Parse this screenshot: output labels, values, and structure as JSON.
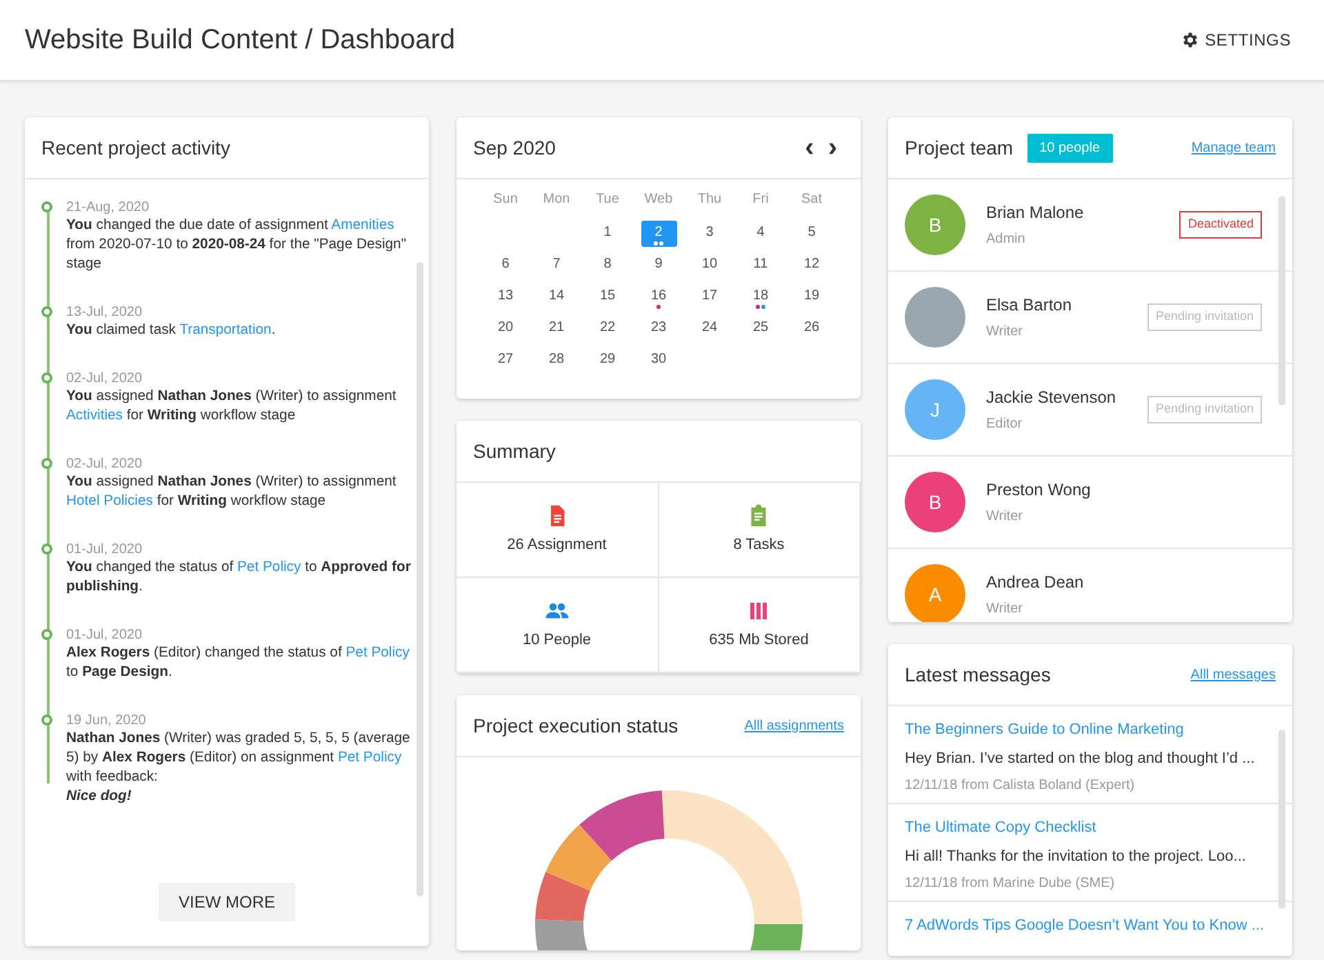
{
  "header": {
    "title": "Website Build Content / Dashboard",
    "settings": "SETTINGS"
  },
  "activity": {
    "title": "Recent project activity",
    "button": "VIEW MORE",
    "entries": [
      {
        "date": "21-Aug, 2020",
        "text": [
          {
            "kind": "bold",
            "text": "You"
          },
          {
            "kind": "plain",
            "text": " changed the due date of assignment "
          },
          {
            "kind": "link",
            "text": "Amenities"
          },
          {
            "kind": "plain",
            "text": " from 2020-07-10 to "
          },
          {
            "kind": "bold",
            "text": "2020-08-24"
          },
          {
            "kind": "plain",
            "text": " for the \"Page Design\" stage"
          }
        ]
      },
      {
        "date": "13-Jul, 2020",
        "text": [
          {
            "kind": "bold",
            "text": "You"
          },
          {
            "kind": "plain",
            "text": " claimed task "
          },
          {
            "kind": "link",
            "text": "Transportation"
          },
          {
            "kind": "plain",
            "text": "."
          }
        ]
      },
      {
        "date": "02-Jul, 2020",
        "text": [
          {
            "kind": "bold",
            "text": "You"
          },
          {
            "kind": "plain",
            "text": " assigned "
          },
          {
            "kind": "bold",
            "text": "Nathan Jones"
          },
          {
            "kind": "plain",
            "text": " (Writer) to assignment "
          },
          {
            "kind": "link",
            "text": "Activities"
          },
          {
            "kind": "plain",
            "text": " for "
          },
          {
            "kind": "bold",
            "text": "Writing"
          },
          {
            "kind": "plain",
            "text": " workflow stage"
          }
        ]
      },
      {
        "date": "02-Jul, 2020",
        "text": [
          {
            "kind": "bold",
            "text": "You"
          },
          {
            "kind": "plain",
            "text": " assigned "
          },
          {
            "kind": "bold",
            "text": "Nathan Jones"
          },
          {
            "kind": "plain",
            "text": " (Writer) to assignment "
          },
          {
            "kind": "link",
            "text": "Hotel Policies"
          },
          {
            "kind": "plain",
            "text": " for "
          },
          {
            "kind": "bold",
            "text": "Writing"
          },
          {
            "kind": "plain",
            "text": " workflow stage"
          }
        ]
      },
      {
        "date": "01-Jul, 2020",
        "text": [
          {
            "kind": "bold",
            "text": "You"
          },
          {
            "kind": "plain",
            "text": " changed the status of "
          },
          {
            "kind": "link",
            "text": "Pet Policy"
          },
          {
            "kind": "plain",
            "text": " to "
          },
          {
            "kind": "bold",
            "text": "Approved for publishing"
          },
          {
            "kind": "plain",
            "text": "."
          }
        ]
      },
      {
        "date": "01-Jul, 2020",
        "text": [
          {
            "kind": "bold",
            "text": "Alex Rogers"
          },
          {
            "kind": "plain",
            "text": " (Editor) changed the status of "
          },
          {
            "kind": "link",
            "text": "Pet Policy"
          },
          {
            "kind": "plain",
            "text": " to "
          },
          {
            "kind": "bold",
            "text": "Page Design"
          },
          {
            "kind": "plain",
            "text": "."
          }
        ]
      },
      {
        "date": "19 Jun, 2020",
        "text": [
          {
            "kind": "bold",
            "text": "Nathan Jones"
          },
          {
            "kind": "plain",
            "text": " (Writer) was graded 5, 5, 5, 5 (average 5) by "
          },
          {
            "kind": "bold",
            "text": "Alex Rogers"
          },
          {
            "kind": "plain",
            "text": " (Editor) on assignment "
          },
          {
            "kind": "link",
            "text": "Pet Policy"
          },
          {
            "kind": "plain",
            "text": " with feedback:"
          },
          {
            "kind": "quote",
            "text": "Nice dog!"
          }
        ]
      }
    ]
  },
  "calendar": {
    "title": "Sep 2020",
    "prev": "‹",
    "next": "›",
    "weekdays": [
      "Sun",
      "Mon",
      "Tue",
      "Web",
      "Thu",
      "Fri",
      "Sat"
    ],
    "weeks": [
      {
        "kind": "leading",
        "days": [
          {
            "day": "1",
            "selected": false
          },
          {
            "day": "2",
            "selected": true,
            "events": [
              {
                "color": "#ffffff"
              },
              {
                "color": "#ffffff"
              }
            ]
          },
          {
            "day": "3",
            "selected": false
          },
          {
            "day": "4",
            "selected": false
          },
          {
            "day": "5",
            "selected": false
          }
        ]
      },
      {
        "kind": "full",
        "days": [
          {
            "day": "6",
            "selected": false
          },
          {
            "day": "7",
            "selected": false
          },
          {
            "day": "8",
            "selected": false
          },
          {
            "day": "9",
            "selected": false
          },
          {
            "day": "10",
            "selected": false
          },
          {
            "day": "11",
            "selected": false
          },
          {
            "day": "12",
            "selected": false
          }
        ]
      },
      {
        "kind": "full",
        "days": [
          {
            "day": "13",
            "selected": false
          },
          {
            "day": "14",
            "selected": false
          },
          {
            "day": "15",
            "selected": false
          },
          {
            "day": "16",
            "selected": false,
            "events": [
              {
                "color": "#e91e63"
              }
            ]
          },
          {
            "day": "17",
            "selected": false
          },
          {
            "day": "18",
            "selected": false,
            "events": [
              {
                "color": "#e91e63"
              },
              {
                "color": "#2196f3"
              }
            ]
          },
          {
            "day": "19",
            "selected": false
          }
        ]
      },
      {
        "kind": "full",
        "days": [
          {
            "day": "20",
            "selected": false
          },
          {
            "day": "21",
            "selected": false
          },
          {
            "day": "22",
            "selected": false
          },
          {
            "day": "23",
            "selected": false
          },
          {
            "day": "24",
            "selected": false
          },
          {
            "day": "25",
            "selected": false
          },
          {
            "day": "26",
            "selected": false
          }
        ]
      },
      {
        "kind": "trailing",
        "days": [
          {
            "day": "27",
            "selected": false
          },
          {
            "day": "28",
            "selected": false
          },
          {
            "day": "29",
            "selected": false
          },
          {
            "day": "30",
            "selected": false
          }
        ]
      }
    ]
  },
  "summary": {
    "title": "Summary",
    "items": [
      {
        "kind": "assignment",
        "label": "26 Assignment"
      },
      {
        "kind": "tasks",
        "label": "8 Tasks"
      },
      {
        "kind": "people",
        "label": "10 People"
      },
      {
        "kind": "storage",
        "label": "635 Mb Stored"
      }
    ]
  },
  "execution": {
    "title": "Project execution status",
    "link": "Alll assignments"
  },
  "team": {
    "title": "Project team",
    "count": "10 people",
    "link": "Manage team",
    "members": [
      {
        "name": "Brian Malone",
        "role": "Admin",
        "avatar": {
          "kind": "initial",
          "text": "B",
          "color": "#7cb342"
        },
        "status": {
          "kind": "danger",
          "label": "Deactivated"
        }
      },
      {
        "name": "Elsa Barton",
        "role": "Writer",
        "avatar": {
          "kind": "photo"
        },
        "status": {
          "kind": "muted",
          "label": "Pending invitation"
        }
      },
      {
        "name": "Jackie Stevenson",
        "role": "Editor",
        "avatar": {
          "kind": "initial",
          "text": "J",
          "color": "#64b5f6"
        },
        "status": {
          "kind": "muted",
          "label": "Pending invitation"
        }
      },
      {
        "name": "Preston Wong",
        "role": "Writer",
        "avatar": {
          "kind": "initial",
          "text": "B",
          "color": "#ec407a"
        }
      },
      {
        "name": "Andrea Dean",
        "role": "Writer",
        "avatar": {
          "kind": "initial",
          "text": "A",
          "color": "#fb8c00"
        }
      }
    ]
  },
  "messages": {
    "title": "Latest messages",
    "link": "Alll messages",
    "items": [
      {
        "title": "The Beginners Guide to Online Marketing",
        "body": "Hey Brian. I’ve started on the blog and thought I’d ...",
        "meta": "12/11/18 from Calista Boland (Expert)"
      },
      {
        "title": "The Ultimate Copy Checklist",
        "body": "Hi all! Thanks for the invitation to the project. Loo...",
        "meta": "12/11/18 from Marine Dube (SME)"
      },
      {
        "title": "7 AdWords Tips Google Doesn’t Want You to Know ..."
      }
    ]
  }
}
